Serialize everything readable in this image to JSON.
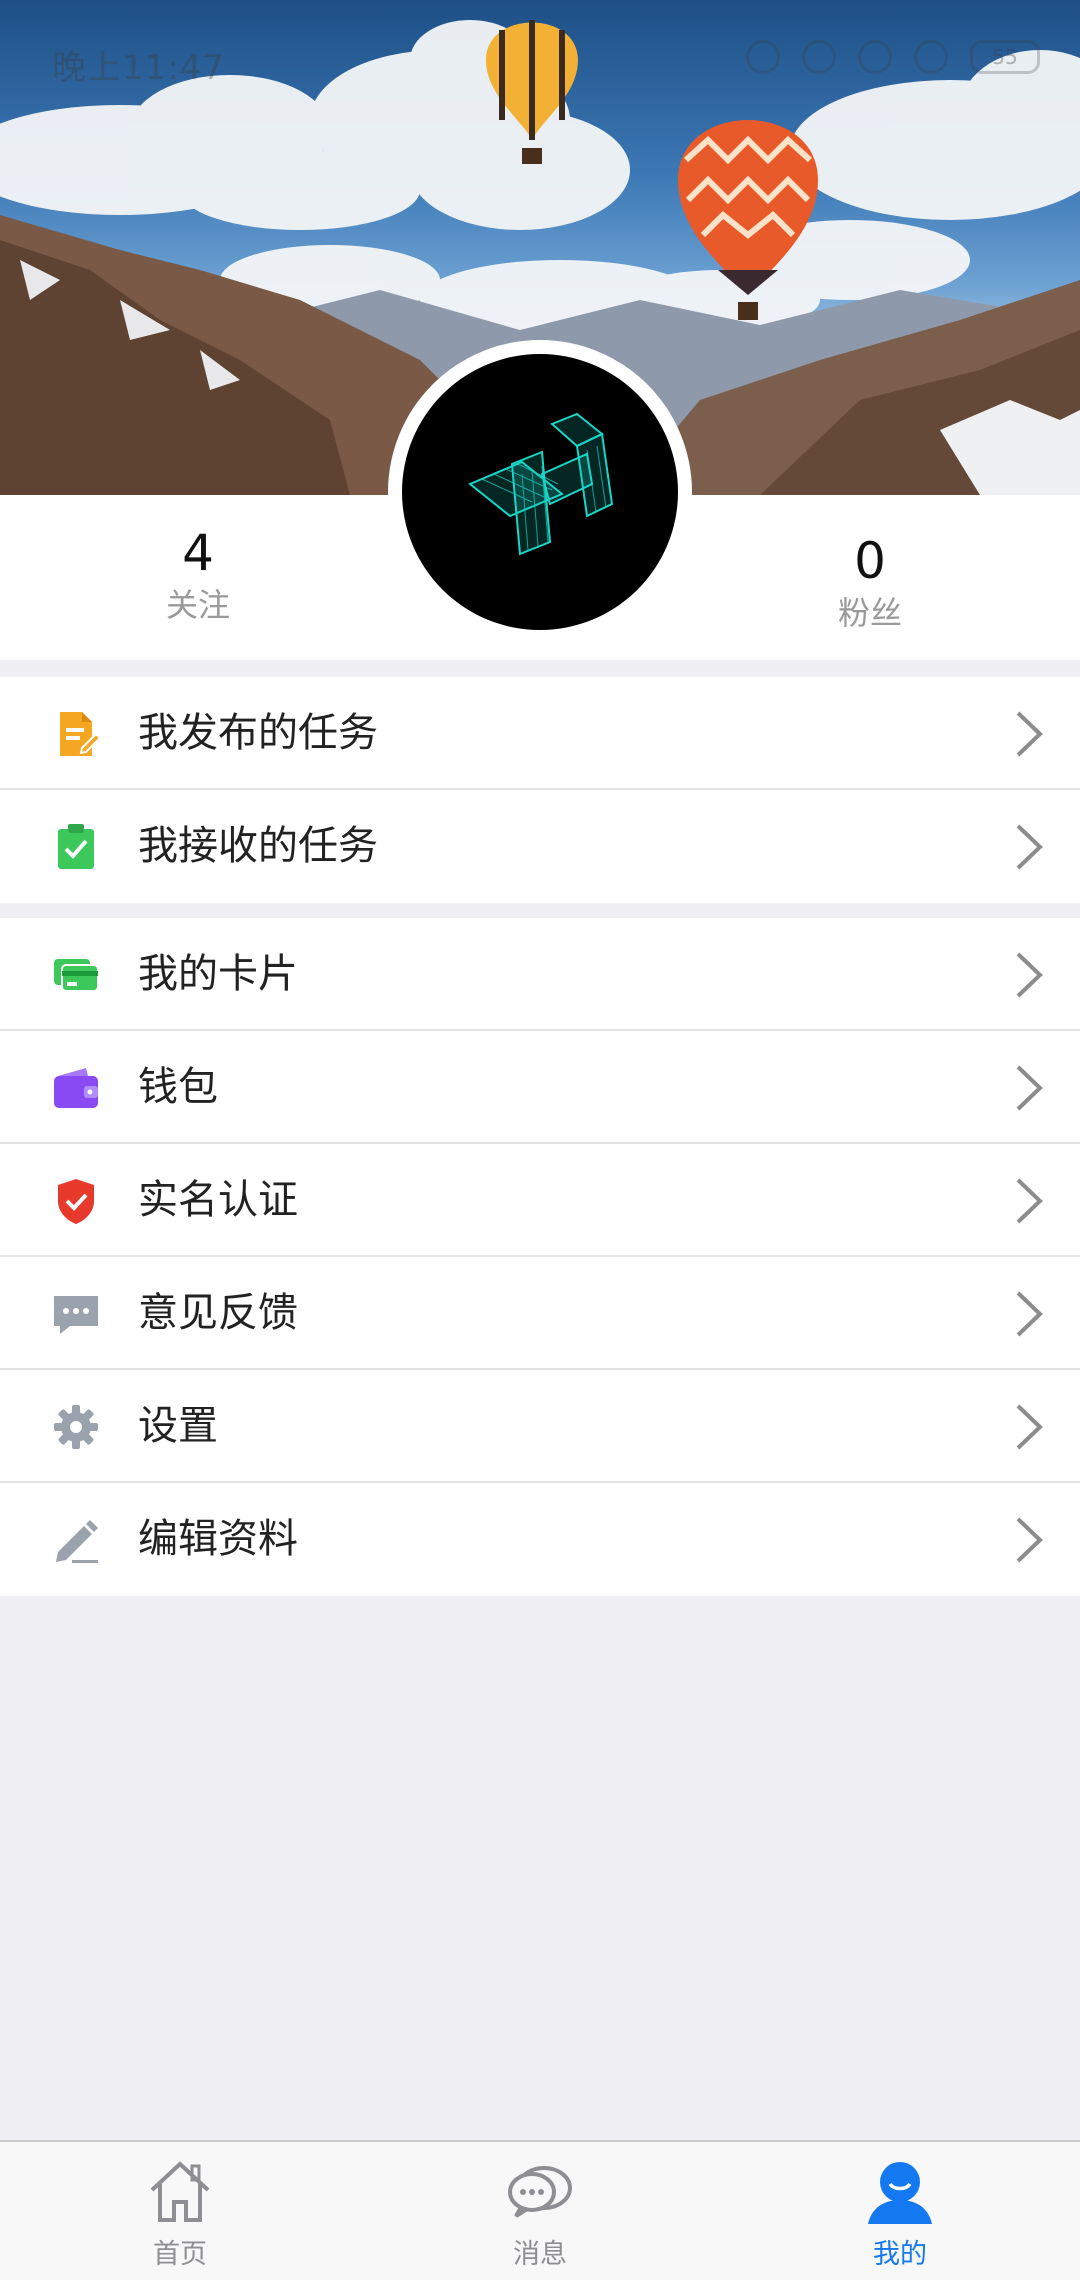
{
  "status_bar": {
    "time": "晚上11:47",
    "battery": "55"
  },
  "profile": {
    "following": {
      "count": "4",
      "label": "关注"
    },
    "followers": {
      "count": "0",
      "label": "粉丝"
    }
  },
  "menu_group_1": [
    {
      "label": "我发布的任务",
      "icon": "document-edit-icon",
      "color": "#f5a623"
    },
    {
      "label": "我接收的任务",
      "icon": "clipboard-check-icon",
      "color": "#3cc85a"
    }
  ],
  "menu_group_2": [
    {
      "label": "我的卡片",
      "icon": "card-icon",
      "color": "#3cc85a"
    },
    {
      "label": "钱包",
      "icon": "wallet-icon",
      "color": "#8a4af3"
    },
    {
      "label": "实名认证",
      "icon": "shield-check-icon",
      "color": "#e8392d"
    },
    {
      "label": "意见反馈",
      "icon": "feedback-icon",
      "color": "#9aa3ad"
    },
    {
      "label": "设置",
      "icon": "gear-icon",
      "color": "#9aa3ad"
    },
    {
      "label": "编辑资料",
      "icon": "pencil-icon",
      "color": "#9aa3ad"
    }
  ],
  "tabbar": {
    "home": "首页",
    "messages": "消息",
    "me": "我的"
  },
  "colors": {
    "accent": "#1478f0",
    "background": "#efeff4"
  }
}
